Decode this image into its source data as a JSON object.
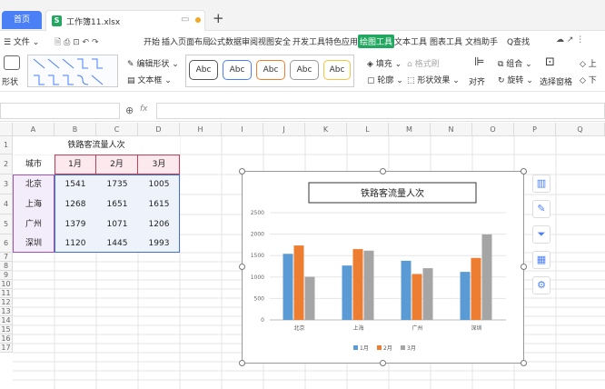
{
  "tabs": {
    "home": "首页",
    "file": "工作簿11.xlsx",
    "new": "+"
  },
  "menubar": {
    "left_icons": "☰ 文件 ⌄",
    "items": [
      "开始",
      "插入",
      "页面布局",
      "公式",
      "数据",
      "审阅",
      "视图",
      "安全",
      "开发工具",
      "特色应用",
      "绘图工具",
      "文本工具",
      "图表工具",
      "文档助手"
    ],
    "active": "绘图工具",
    "search": "Q查找"
  },
  "ribbon": {
    "shape_label": "形状",
    "edit_shape": "编辑形状",
    "text_box": "文本框",
    "style_samples": [
      "Abc",
      "Abc",
      "Abc",
      "Abc",
      "Abc"
    ],
    "fill": "填充",
    "format_brush": "格式刷",
    "outline": "轮廓",
    "shape_effects": "形状效果",
    "align": "对齐",
    "group": "组合",
    "rotate": "旋转",
    "select_pane": "选择窗格",
    "up": "上",
    "down": "下"
  },
  "formula_bar": {
    "zoom_icon": "⊕",
    "fx": "fx"
  },
  "columns": [
    "A",
    "B",
    "C",
    "D",
    "E",
    "F",
    "G",
    "H",
    "I",
    "J",
    "K",
    "L",
    "M",
    "N",
    "O",
    "P",
    "Q"
  ],
  "rows": [
    "1",
    "2",
    "3",
    "4",
    "5",
    "6",
    "7",
    "8",
    "9",
    "10",
    "11",
    "12",
    "13",
    "14",
    "15",
    "16",
    "17"
  ],
  "table": {
    "title": "铁路客流量人次",
    "header": [
      "城市",
      "1月",
      "2月",
      "3月"
    ],
    "rows": [
      [
        "北京",
        "1541",
        "1735",
        "1005"
      ],
      [
        "上海",
        "1268",
        "1651",
        "1615"
      ],
      [
        "广州",
        "1379",
        "1071",
        "1206"
      ],
      [
        "深圳",
        "1120",
        "1445",
        "1993"
      ]
    ]
  },
  "chart_data": {
    "type": "bar",
    "title": "铁路客流量人次",
    "categories": [
      "北京",
      "上海",
      "广州",
      "深圳"
    ],
    "series": [
      {
        "name": "1月",
        "values": [
          1541,
          1268,
          1379,
          1120
        ],
        "color": "#5b9bd5"
      },
      {
        "name": "2月",
        "values": [
          1735,
          1651,
          1071,
          1445
        ],
        "color": "#ed7d31"
      },
      {
        "name": "3月",
        "values": [
          1005,
          1615,
          1206,
          1993
        ],
        "color": "#a5a5a5"
      }
    ],
    "yticks": [
      "0",
      "500",
      "1000",
      "1500",
      "2000",
      "2500"
    ],
    "ylim": [
      0,
      2500
    ],
    "legend": "bottom"
  },
  "side_buttons": [
    "chart-elements-icon",
    "chart-style-icon",
    "chart-filter-icon",
    "chart-type-icon",
    "chart-settings-icon"
  ]
}
